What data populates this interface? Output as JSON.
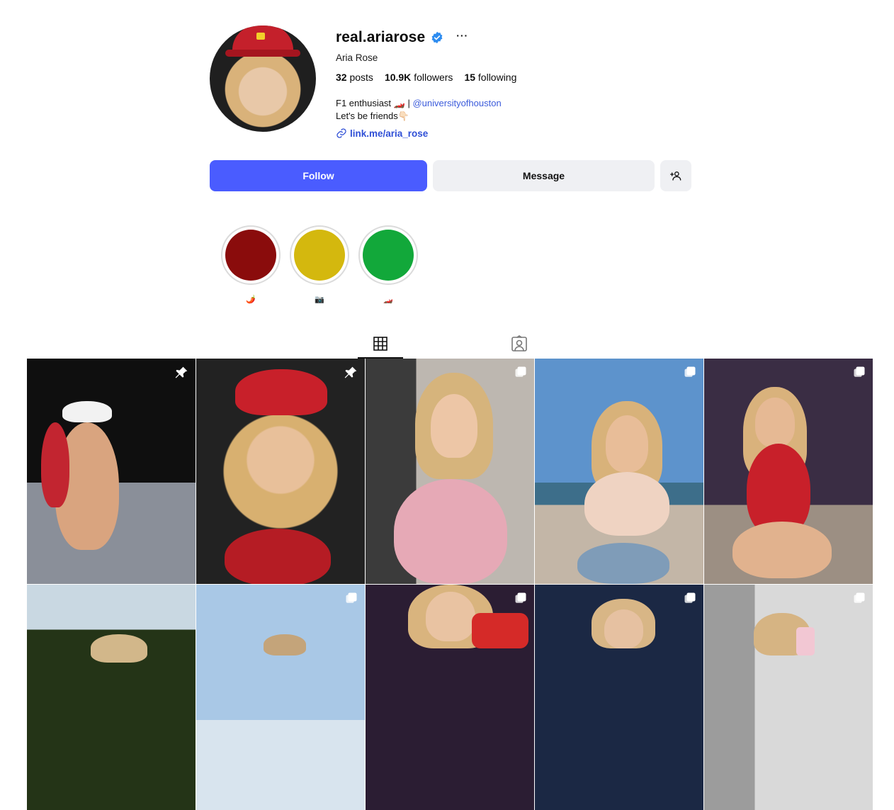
{
  "profile": {
    "username": "real.ariarose",
    "full_name": "Aria Rose",
    "verified": true,
    "stats": {
      "posts_count": "32",
      "posts_label": "posts",
      "followers_count": "10.9K",
      "followers_label": "followers",
      "following_count": "15",
      "following_label": "following"
    },
    "bio_line1": "F1 enthusiast 🏎️ |",
    "bio_mention": "@universityofhouston",
    "bio_line2": "Let's be friends👇🏻",
    "link": "link.me/aria_rose"
  },
  "actions": {
    "follow_label": "Follow",
    "message_label": "Message",
    "suggest_icon": "add-person-icon"
  },
  "highlights": [
    {
      "emoji": "🌶️",
      "color": "#8a0c0c"
    },
    {
      "emoji": "📷",
      "color": "#d4b80e"
    },
    {
      "emoji": "🏎️",
      "color": "#12a83a"
    }
  ],
  "tabs": [
    {
      "icon": "grid-icon",
      "active": true
    },
    {
      "icon": "tagged-icon",
      "active": false
    }
  ],
  "posts": [
    {
      "badge": "pin-icon",
      "bg": "#141414"
    },
    {
      "badge": "pin-icon",
      "bg": "#1c1c1c"
    },
    {
      "badge": "carousel-icon",
      "bg": "#8d8a87"
    },
    {
      "badge": "carousel-icon",
      "bg": "#6f9fd3"
    },
    {
      "badge": "carousel-icon",
      "bg": "#4a3b4e"
    },
    {
      "badge": "",
      "bg": "#2d3b22"
    },
    {
      "badge": "carousel-icon",
      "bg": "#b9d3ea"
    },
    {
      "badge": "carousel-icon",
      "bg": "#3a2a40"
    },
    {
      "badge": "carousel-icon",
      "bg": "#1a2438"
    },
    {
      "badge": "carousel-icon",
      "bg": "#c9c9c9"
    }
  ]
}
